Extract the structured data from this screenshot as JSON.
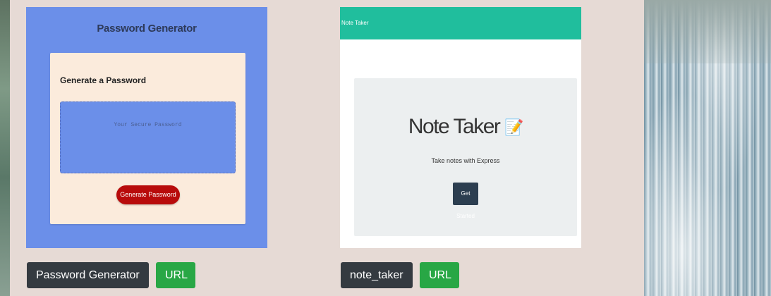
{
  "projects": [
    {
      "name": "Password Generator",
      "url_label": "URL",
      "thumbnail": {
        "title": "Password Generator",
        "subtitle": "Generate a Password",
        "placeholder": "Your Secure Password",
        "button": "Generate Password"
      }
    },
    {
      "name": "note_taker",
      "url_label": "URL",
      "thumbnail": {
        "brand": "Note Taker",
        "heading": "Note Taker",
        "pencil": "📝",
        "lead": "Take notes with Express",
        "button": "Get Started"
      }
    }
  ],
  "colors": {
    "panel": "#e6dad5",
    "pw_background": "#6b8fe9",
    "pw_card": "#fbebdc",
    "pw_button": "#b80b0b",
    "nt_navbar": "#20be9d",
    "badge_dark": "#343a40",
    "badge_green": "#28a745"
  }
}
